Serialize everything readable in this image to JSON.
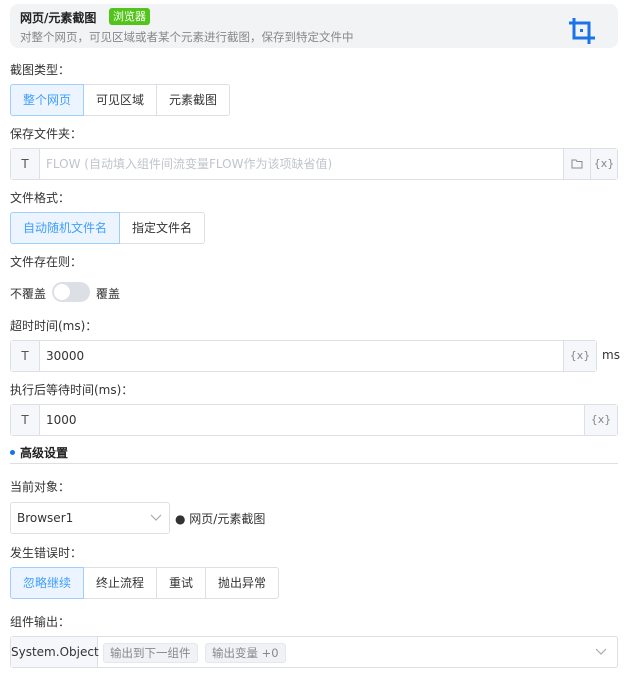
{
  "header": {
    "title": "网页/元素截图",
    "badge": "浏览器",
    "description": "对整个网页，可见区域或者某个元素进行截图，保存到特定文件中",
    "icon": "crop-icon",
    "accent_color": "#1a73e8"
  },
  "screenshot_type": {
    "label": "截图类型：",
    "options": [
      "整个网页",
      "可见区域",
      "元素截图"
    ],
    "selected": "整个网页"
  },
  "save_folder": {
    "label": "保存文件夹：",
    "prefix": "T",
    "placeholder": "FLOW (自动填入组件间流变量FLOW作为该项缺省值)",
    "variable_button": "{x}",
    "folder_icon": "folder-icon"
  },
  "file_format": {
    "label": "文件格式：",
    "options": [
      "自动随机文件名",
      "指定文件名"
    ],
    "selected": "自动随机文件名"
  },
  "file_exists": {
    "label": "文件存在则：",
    "off_label": "不覆盖",
    "on_label": "覆盖",
    "enabled": false
  },
  "timeout": {
    "label": "超时时间(ms)：",
    "prefix": "T",
    "value": "30000",
    "variable_button": "{x}",
    "unit": "ms"
  },
  "wait_after": {
    "label": "执行后等待时间(ms)：",
    "prefix": "T",
    "value": "1000",
    "variable_button": "{x}"
  },
  "advanced": {
    "title": "高级设置"
  },
  "current_object": {
    "label": "当前对象：",
    "value": "Browser1",
    "note": "网页/元素截图"
  },
  "on_error": {
    "label": "发生错误时：",
    "options": [
      "忽略继续",
      "终止流程",
      "重试",
      "抛出异常"
    ],
    "selected": "忽略继续"
  },
  "output": {
    "label": "组件输出：",
    "type": "System.Object",
    "tags": [
      "输出到下一组件",
      "输出变量 +0"
    ]
  }
}
